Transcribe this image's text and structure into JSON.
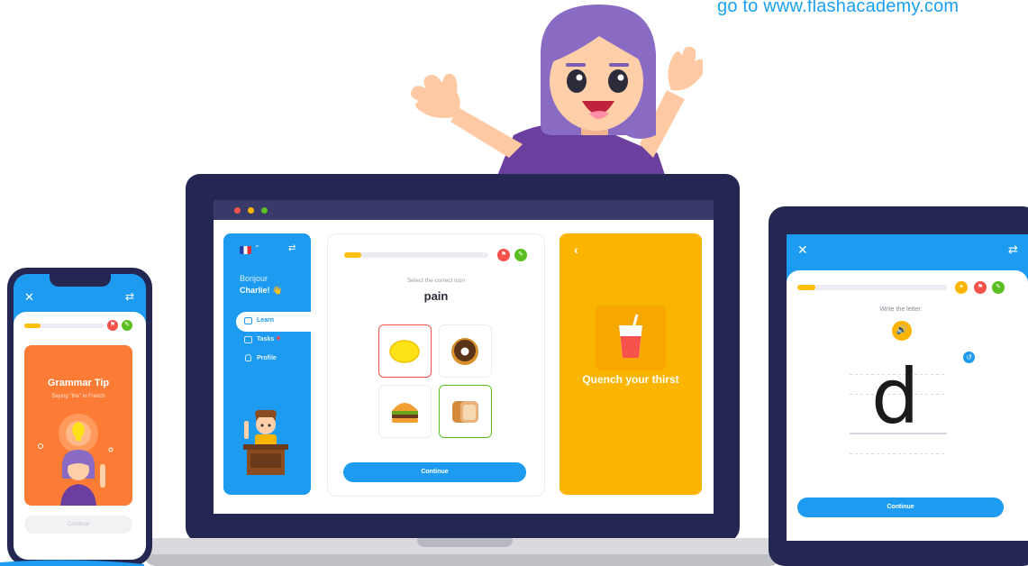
{
  "promo": {
    "url": "go to www.flashacademy.com"
  },
  "laptop": {
    "sidebar": {
      "greeting": "Bonjour",
      "name": "Charlie! 👋",
      "nav": [
        "Learn",
        "Tasks",
        "Profile"
      ]
    },
    "lesson": {
      "instruction": "Select the correct icon",
      "word": "pain",
      "options": [
        "lemon",
        "donut",
        "burger",
        "bread"
      ],
      "continue": "Continue",
      "progress": 0.12
    },
    "card": {
      "title": "Quench your thirst"
    }
  },
  "phone": {
    "tip_title": "Grammar Tip",
    "tip_subtitle": "Saying \"the\" in French",
    "continue": "Continue",
    "progress": 0.2
  },
  "tablet": {
    "instruction": "Write the letter:",
    "letter": "d",
    "continue": "Continue",
    "progress": 0.12
  },
  "colors": {
    "accent": "#1c9bf0",
    "navy": "#242752",
    "yellow": "#fbb500",
    "orange": "#fd7c35",
    "red": "#f4524b",
    "green": "#5bbf21"
  }
}
